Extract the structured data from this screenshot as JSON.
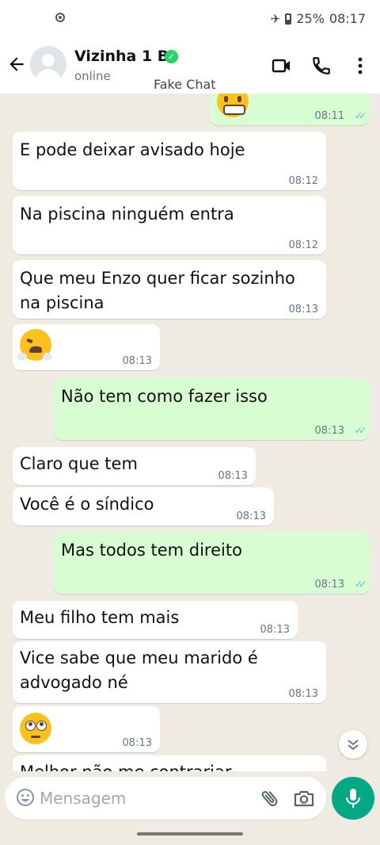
{
  "status_bar": {
    "battery": "25%",
    "time": "08:17"
  },
  "header": {
    "contact_name": "Vizinha 1 B",
    "contact_status": "online",
    "watermark": "Fake Chat",
    "icons": [
      "back-arrow-icon",
      "video-call-icon",
      "voice-call-icon",
      "more-options-icon"
    ]
  },
  "messages": [
    {
      "direction": "out",
      "emoji": "grimacing-face",
      "time": "08:11",
      "read": true
    },
    {
      "direction": "in",
      "text": "E pode deixar avisado hoje",
      "time": "08:12"
    },
    {
      "direction": "in",
      "text": "Na piscina ninguém entra",
      "time": "08:12"
    },
    {
      "direction": "in",
      "text": "Que meu Enzo quer ficar sozinho\nna piscina",
      "time": "08:13"
    },
    {
      "direction": "in",
      "emoji": "face-with-steam-from-nose",
      "time": "08:13"
    },
    {
      "direction": "out",
      "text": "Não tem como fazer isso",
      "time": "08:13",
      "read": true
    },
    {
      "direction": "in",
      "text": "Claro que tem",
      "time": "08:13"
    },
    {
      "direction": "in",
      "text": "Você é o síndico",
      "time": "08:13"
    },
    {
      "direction": "out",
      "text": "Mas todos tem direito",
      "time": "08:13",
      "read": true
    },
    {
      "direction": "in",
      "text": "Meu filho tem mais",
      "time": "08:13"
    },
    {
      "direction": "in",
      "text": "Vice sabe que meu marido é\nadvogado né",
      "time": "08:13"
    },
    {
      "direction": "in",
      "emoji": "face-with-rolling-eyes",
      "time": "08:13"
    },
    {
      "direction": "in",
      "text": "Melhor não me contrariar",
      "time": ""
    }
  ],
  "composer": {
    "placeholder": "Mensagem"
  },
  "colors": {
    "accent": "#00a884",
    "outgoing_bubble": "#d9fdd3",
    "incoming_bubble": "#ffffff",
    "read_ticks": "#53bdeb",
    "chat_background": "#efeae2"
  }
}
